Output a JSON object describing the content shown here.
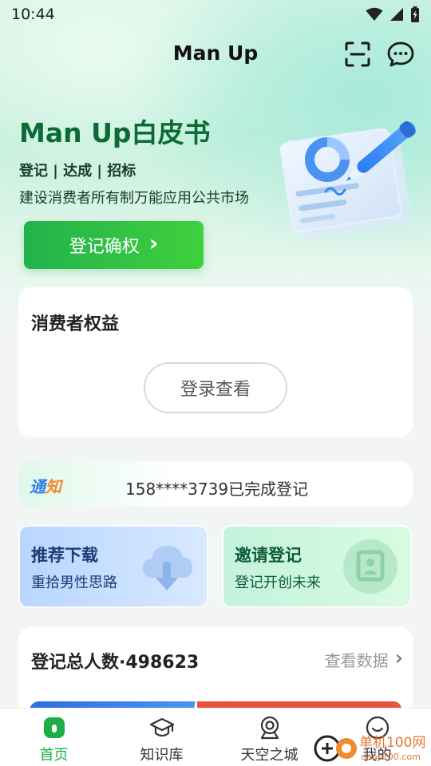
{
  "status_bar": {
    "time": "10:44"
  },
  "app_bar": {
    "title": "Man Up"
  },
  "hero": {
    "title": "Man Up白皮书",
    "subtitle": "登记 | 达成 | 招标",
    "description": "建设消费者所有制万能应用公共市场",
    "button_label": "登记确权",
    "button_arrow": "›"
  },
  "rights_card": {
    "title": "消费者权益",
    "login_button": "登录查看"
  },
  "notice": {
    "tag_part1": "通",
    "tag_part2": "知",
    "text": "158****3739已完成登记"
  },
  "promos": [
    {
      "title": "推荐下载",
      "subtitle": "重拾男性思路",
      "icon": "cloud-download-icon"
    },
    {
      "title": "邀请登记",
      "subtitle": "登记开创未来",
      "icon": "contact-card-icon"
    }
  ],
  "stats": {
    "title": "登记总人数·498623",
    "link_label": "查看数据",
    "link_arrow": "›"
  },
  "bottom_nav": {
    "items": [
      {
        "label": "首页",
        "icon": "home-icon",
        "active": true
      },
      {
        "label": "知识库",
        "icon": "graduation-cap-icon",
        "active": false
      },
      {
        "label": "天空之城",
        "icon": "location-pin-icon",
        "active": false
      },
      {
        "label": "我的",
        "icon": "smiley-icon",
        "active": false
      }
    ]
  },
  "colors": {
    "brand_green": "#1fae46",
    "hero_title": "#0c6b34",
    "notice_blue": "#2f7ee8",
    "notice_orange": "#f08c2b"
  }
}
